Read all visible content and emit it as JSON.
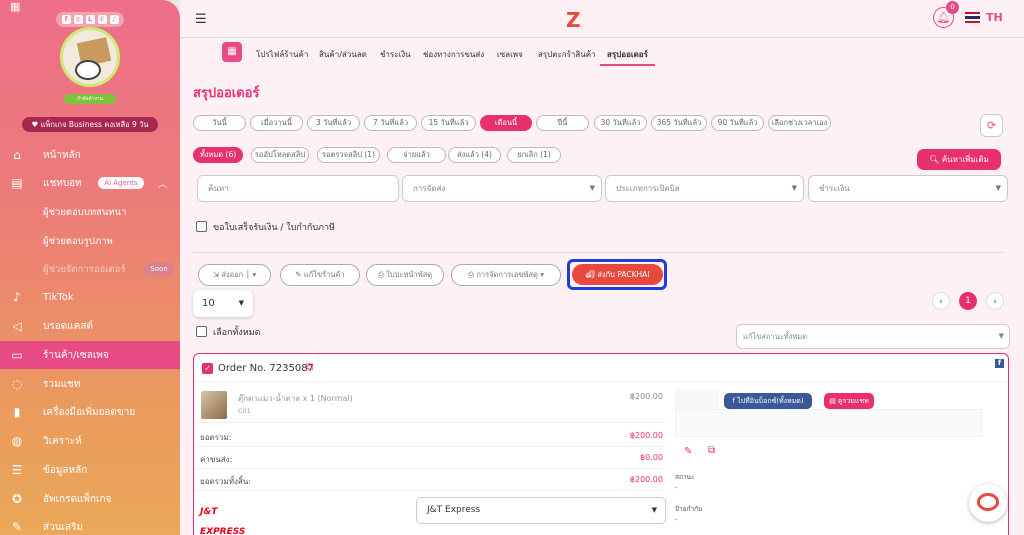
{
  "sidebar": {
    "social_icons": [
      "facebook-icon",
      "instagram-icon",
      "line-icon",
      "whatsapp-icon",
      "tiktok-icon"
    ],
    "status_pill": "กำลังทำงาน",
    "package": "แพ็กเกจ Business คงเหลือ 9 วัน",
    "nav": [
      {
        "label": "หน้าหลัก",
        "icon": "home-icon"
      },
      {
        "label": "แชทบอท",
        "icon": "chat-icon",
        "badge": "Ai Agents"
      },
      {
        "label": "ผู้ช่วยตอบบทสนทนา"
      },
      {
        "label": "ผู้ช่วยตอบรูปภาพ"
      },
      {
        "label": "ผู้ช่วยจัดการออเดอร์",
        "badge": "Soon"
      },
      {
        "label": "TikTok",
        "icon": "tiktok-icon"
      },
      {
        "label": "บรอดแคสต์",
        "icon": "megaphone-icon"
      },
      {
        "label": "ร้านค้า/เซลเพจ",
        "icon": "store-icon"
      },
      {
        "label": "รวมแชท",
        "icon": "chats-icon"
      },
      {
        "label": "เครื่องมือเพิ่มยอดขาย",
        "icon": "chart-bars-icon"
      },
      {
        "label": "วิเคราะห์",
        "icon": "analytics-icon"
      },
      {
        "label": "ข้อมูลหลัก",
        "icon": "table-icon"
      },
      {
        "label": "อัพเกรดแพ็กเกจ",
        "icon": "award-icon"
      },
      {
        "label": "ส่วนเสริม",
        "icon": "addon-icon"
      }
    ]
  },
  "topbar": {
    "notification_count": "0",
    "language": "TH",
    "accent": "#e84a85"
  },
  "tabs": [
    "โปรไฟล์ร้านค้า",
    "สินค้า/ส่วนลด",
    "ชำระเงิน",
    "ช่องทางการขนส่ง",
    "เซลเพจ",
    "สรุปตะกร้าสินค้า",
    "สรุปออเดอร์"
  ],
  "page_title": "สรุปออเดอร์",
  "date_filters": [
    "วันนี้",
    "เมื่อวานนี้",
    "3 วันที่แล้ว",
    "7 วันที่แล้ว",
    "15 วันที่แล้ว",
    "เดือนนี้",
    "ปีนี้",
    "30 วันที่แล้ว",
    "365 วันที่แล้ว",
    "90 วันที่แล้ว",
    "เลือกช่วงเวลาเอง"
  ],
  "selected_date_filter": "เดือนนี้",
  "status_filters": [
    "ทั้งหมด (6)",
    "รออัปโหลดสลิป",
    "รอตรวจสลิป (1)",
    "จ่ายแล้ว",
    "ส่งแล้ว (4)",
    "ยกเลิก (1)"
  ],
  "search_more_button": "ค้นหาเพิ่มเติม",
  "fields": {
    "search": "ค้นหา",
    "shipping": "การจัดส่ง",
    "bill_type": "ประเภทการเปิดบิล",
    "payment": "ชำระเงิน"
  },
  "receipt_checkbox": "ขอใบเสร็จรับเงิน / ใบกำกับภาษี",
  "actions": {
    "export": "ส่งออก",
    "edit_shop": "แก้ไขร้านค้า",
    "print_label": "ใบปะหน้าพัสดุ",
    "manage_tracking": "การจัดการเลขพัสดุ",
    "packhai": "ส่งกับ PACKHAI"
  },
  "per_page": "10",
  "pagination": {
    "current": "1",
    "prev": "‹",
    "next": "›"
  },
  "select_all": "เลือกทั้งหมด",
  "status_filter_placeholder": "แก้ไขสถานะทั้งหมด",
  "order": {
    "number": "Order No. 7235087",
    "product": "ตุ๊กตาแมว-น้ำตาล x 1 (Normal)",
    "sku": "C01",
    "product_price": "฿200.00",
    "rows": [
      {
        "label": "ยอดรวม:",
        "value": "฿200.00"
      },
      {
        "label": "ค่าขนส่ง:",
        "value": "฿0.00"
      },
      {
        "label": "ยอดรวมทั้งสิ้น:",
        "value": "฿200.00"
      }
    ],
    "fb_button": "ไปที่อินบ็อกซ์(ทั้งหมด)",
    "chat_button": "ดูรวมแชท",
    "status_label": "สถานะ",
    "status_value": "-",
    "tag_label": "ป้ายกำกับ",
    "tag_value": "-",
    "carrier_logo": "J&T EXPRESS",
    "carrier": "J&T Express"
  }
}
